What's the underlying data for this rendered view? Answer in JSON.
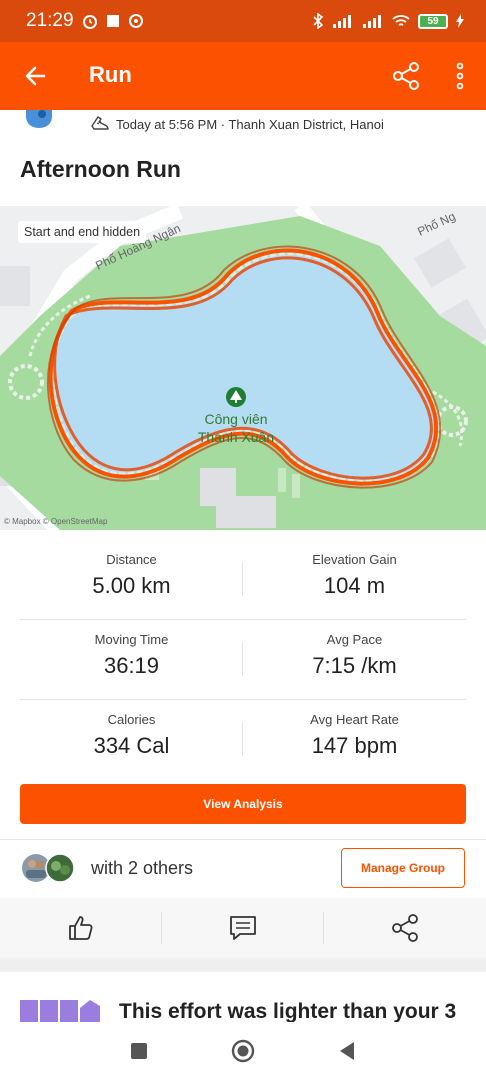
{
  "status_bar": {
    "time": "21:29",
    "battery": "59"
  },
  "app_bar": {
    "title": "Run"
  },
  "meta": {
    "datetime_location": "Today at 5:56 PM · Thanh Xuan District, Hanoi"
  },
  "activity": {
    "title": "Afternoon Run"
  },
  "map": {
    "badge": "Start and end hidden",
    "labels": [
      "Phố Hoàng Ngân",
      "Phố Ng",
      "Công viên",
      "Thanh Xuân"
    ],
    "attribution": "© Mapbox © OpenStreetMap"
  },
  "stats": [
    {
      "label": "Distance",
      "value": "5.00 km"
    },
    {
      "label": "Elevation Gain",
      "value": "104 m"
    },
    {
      "label": "Moving Time",
      "value": "36:19"
    },
    {
      "label": "Avg Pace",
      "value": "7:15 /km"
    },
    {
      "label": "Calories",
      "value": "334 Cal"
    },
    {
      "label": "Avg Heart Rate",
      "value": "147 bpm"
    }
  ],
  "buttons": {
    "view_analysis": "View Analysis",
    "manage_group": "Manage Group"
  },
  "group": {
    "with_others": "with 2 others"
  },
  "insight": {
    "text": "This effort was lighter than your 3"
  },
  "colors": {
    "brand": "#fc5200",
    "status_bar": "#d94a0c",
    "map_water": "#b4dcf2",
    "map_park": "#a6dba0"
  }
}
